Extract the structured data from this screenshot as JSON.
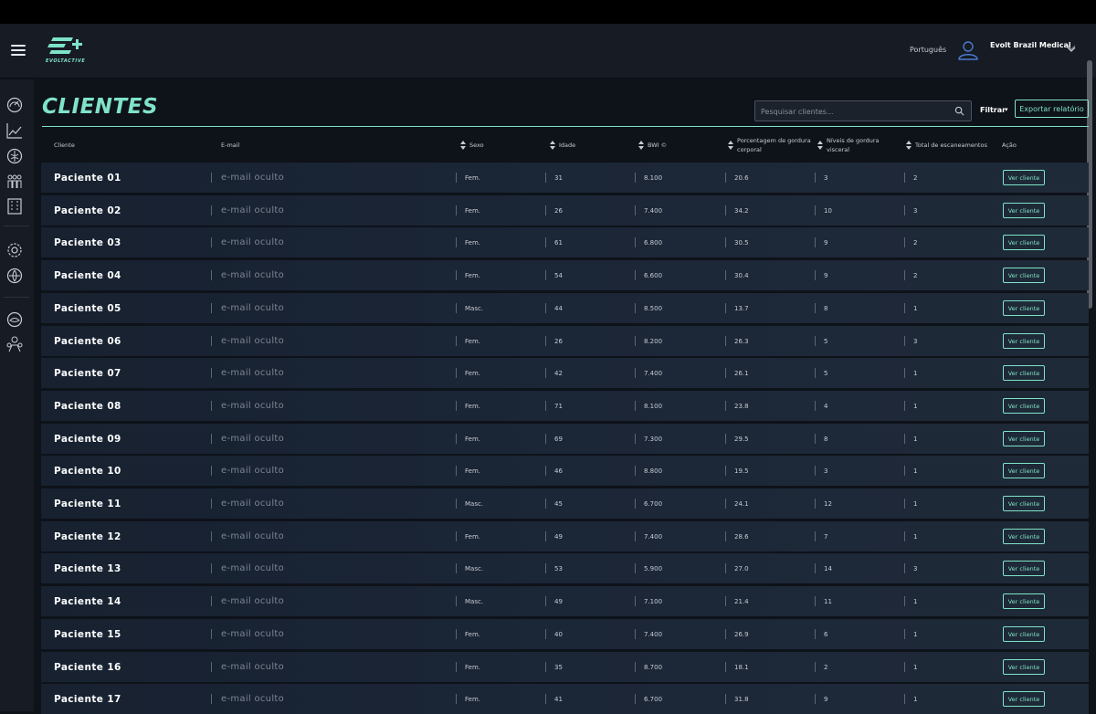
{
  "header": {
    "brand": "EVOLTACTIVE",
    "language": "Português",
    "account": "Evolt Brazil Medical"
  },
  "page": {
    "title": "CLIENTES",
    "search_placeholder": "Pesquisar clientes...",
    "filter_label": "Filtrar",
    "export_label": "Exportar relatório"
  },
  "table": {
    "columns": {
      "client": "Cliente",
      "email": "E-mail",
      "sex": "Sexo",
      "age": "Idade",
      "bwi": "BWI ©",
      "bodyfat_1": "Porcentagem de gordura",
      "bodyfat_2": "corporal",
      "visceral_1": "Níveis de gordura",
      "visceral_2": "visceral",
      "scans": "Total de escaneamentos",
      "action": "Ação"
    },
    "action_label": "Ver cliente",
    "rows": [
      {
        "name": "Paciente 01",
        "email": "e-mail oculto",
        "sex": "Fem.",
        "age": "31",
        "bwi": "8.100",
        "fat": "20.6",
        "visceral": "3",
        "scans": "2"
      },
      {
        "name": "Paciente 02",
        "email": "e-mail oculto",
        "sex": "Fem.",
        "age": "26",
        "bwi": "7.400",
        "fat": "34.2",
        "visceral": "10",
        "scans": "3"
      },
      {
        "name": "Paciente 03",
        "email": "e-mail oculto",
        "sex": "Fem.",
        "age": "61",
        "bwi": "6.800",
        "fat": "30.5",
        "visceral": "9",
        "scans": "2"
      },
      {
        "name": "Paciente 04",
        "email": "e-mail oculto",
        "sex": "Fem.",
        "age": "54",
        "bwi": "6.600",
        "fat": "30.4",
        "visceral": "9",
        "scans": "2"
      },
      {
        "name": "Paciente 05",
        "email": "e-mail oculto",
        "sex": "Masc.",
        "age": "44",
        "bwi": "8.500",
        "fat": "13.7",
        "visceral": "8",
        "scans": "1"
      },
      {
        "name": "Paciente 06",
        "email": "e-mail oculto",
        "sex": "Fem.",
        "age": "26",
        "bwi": "8.200",
        "fat": "26.3",
        "visceral": "5",
        "scans": "3"
      },
      {
        "name": "Paciente 07",
        "email": "e-mail oculto",
        "sex": "Fem.",
        "age": "42",
        "bwi": "7.400",
        "fat": "26.1",
        "visceral": "5",
        "scans": "1"
      },
      {
        "name": "Paciente 08",
        "email": "e-mail oculto",
        "sex": "Fem.",
        "age": "71",
        "bwi": "8.100",
        "fat": "23.8",
        "visceral": "4",
        "scans": "1"
      },
      {
        "name": "Paciente 09",
        "email": "e-mail oculto",
        "sex": "Fem.",
        "age": "69",
        "bwi": "7.300",
        "fat": "29.5",
        "visceral": "8",
        "scans": "1"
      },
      {
        "name": "Paciente 10",
        "email": "e-mail oculto",
        "sex": "Fem.",
        "age": "46",
        "bwi": "8.800",
        "fat": "19.5",
        "visceral": "3",
        "scans": "1"
      },
      {
        "name": "Paciente 11",
        "email": "e-mail oculto",
        "sex": "Masc.",
        "age": "45",
        "bwi": "6.700",
        "fat": "24.1",
        "visceral": "12",
        "scans": "1"
      },
      {
        "name": "Paciente 12",
        "email": "e-mail oculto",
        "sex": "Fem.",
        "age": "49",
        "bwi": "7.400",
        "fat": "28.6",
        "visceral": "7",
        "scans": "1"
      },
      {
        "name": "Paciente 13",
        "email": "e-mail oculto",
        "sex": "Masc.",
        "age": "53",
        "bwi": "5.900",
        "fat": "27.0",
        "visceral": "14",
        "scans": "3"
      },
      {
        "name": "Paciente 14",
        "email": "e-mail oculto",
        "sex": "Masc.",
        "age": "49",
        "bwi": "7.100",
        "fat": "21.4",
        "visceral": "11",
        "scans": "1"
      },
      {
        "name": "Paciente 15",
        "email": "e-mail oculto",
        "sex": "Fem.",
        "age": "40",
        "bwi": "7.400",
        "fat": "26.9",
        "visceral": "6",
        "scans": "1"
      },
      {
        "name": "Paciente 16",
        "email": "e-mail oculto",
        "sex": "Fem.",
        "age": "35",
        "bwi": "8.700",
        "fat": "18.1",
        "visceral": "2",
        "scans": "1"
      },
      {
        "name": "Paciente 17",
        "email": "e-mail oculto",
        "sex": "Fem.",
        "age": "41",
        "bwi": "6.700",
        "fat": "31.8",
        "visceral": "9",
        "scans": "1"
      }
    ]
  },
  "sidebar": {
    "icons": [
      "dashboard-gauge-icon",
      "analytics-chart-icon",
      "brain-icon",
      "users-group-icon",
      "building-icon",
      "settings-gear-icon",
      "integrations-icon",
      "support-icon",
      "team-icon"
    ]
  },
  "colors": {
    "accent": "#7fe3c8",
    "background": "#0e1219",
    "panel": "#161b24"
  }
}
